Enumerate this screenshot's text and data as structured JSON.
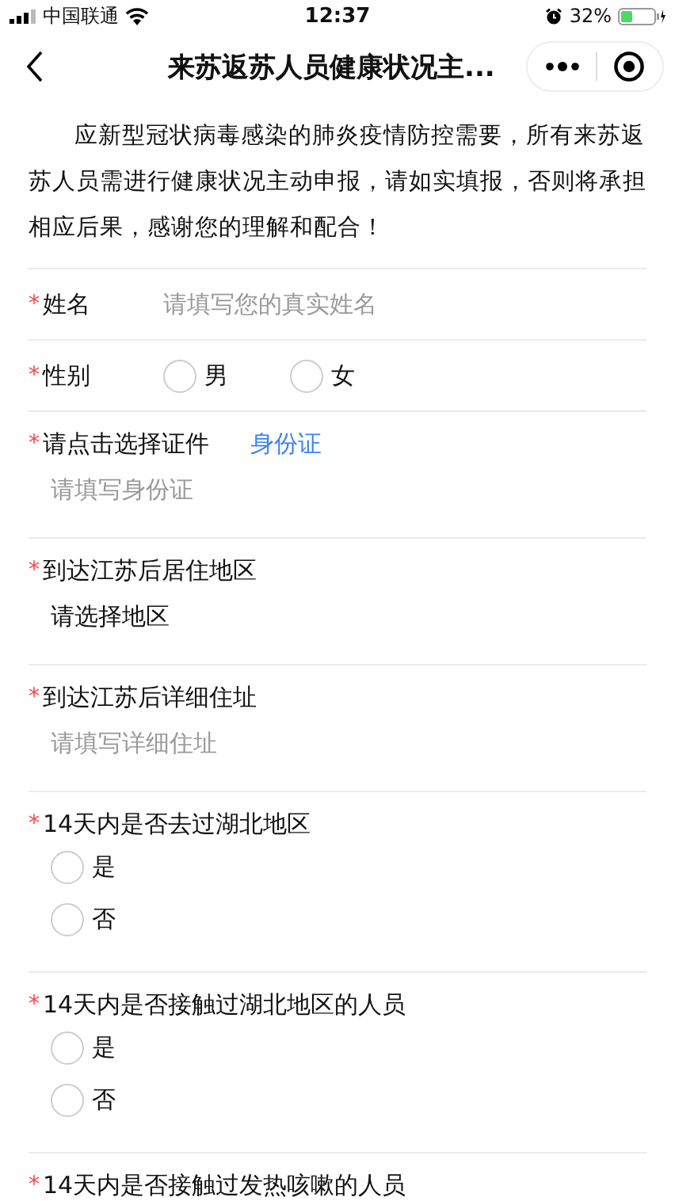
{
  "status_bar": {
    "carrier": "中国联通",
    "time": "12:37",
    "battery": "32%"
  },
  "nav": {
    "title": "来苏返苏人员健康状况主..."
  },
  "required_mark": "*",
  "intro": "应新型冠状病毒感染的肺炎疫情防控需要，所有来苏返苏人员需进行健康状况主动申报，请如实填报，否则将承担相应后果，感谢您的理解和配合！",
  "fields": [
    {
      "kind": "inline_text",
      "required": true,
      "label": "姓名",
      "placeholder": "请填写您的真实姓名"
    },
    {
      "kind": "inline_radio",
      "required": true,
      "label": "性别",
      "options": [
        {
          "label": "男",
          "selected": false
        },
        {
          "label": "女",
          "selected": false
        }
      ]
    },
    {
      "kind": "id",
      "required": true,
      "label": "请点击选择证件",
      "link": "身份证",
      "placeholder": "请填写身份证"
    },
    {
      "kind": "select",
      "required": true,
      "label": "到达江苏后居住地区",
      "value": "请选择地区"
    },
    {
      "kind": "text",
      "required": true,
      "label": "到达江苏后详细住址",
      "placeholder": "请填写详细住址"
    },
    {
      "kind": "radio",
      "required": true,
      "label": "14天内是否去过湖北地区",
      "options": [
        {
          "label": "是",
          "selected": false
        },
        {
          "label": "否",
          "selected": false
        }
      ]
    },
    {
      "kind": "radio",
      "required": true,
      "label": "14天内是否接触过湖北地区的人员",
      "options": [
        {
          "label": "是",
          "selected": false
        },
        {
          "label": "否",
          "selected": false
        }
      ]
    },
    {
      "kind": "radio",
      "required": true,
      "label": "14天内是否接触过发热咳嗽的人员"
    }
  ]
}
